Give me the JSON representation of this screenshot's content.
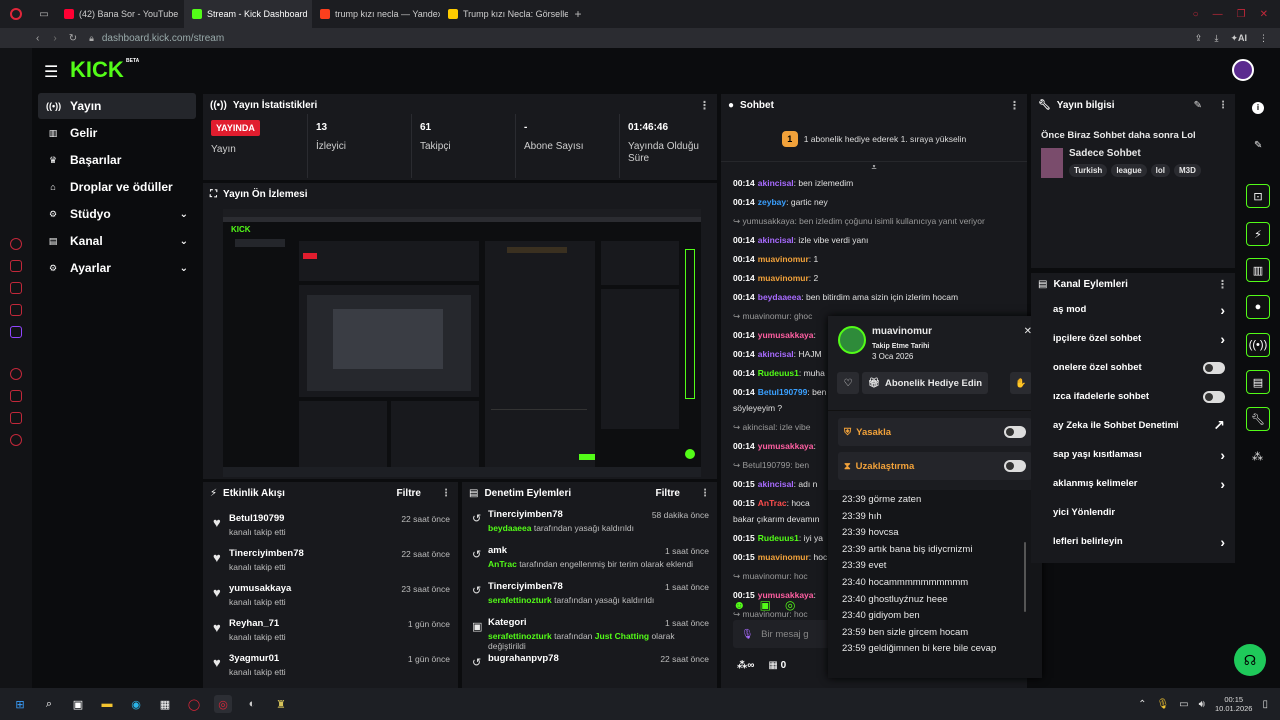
{
  "browser": {
    "tabs": [
      {
        "label": "(42) Bana Sor - YouTube",
        "icon": "youtube-icon",
        "color": "#ff0033"
      },
      {
        "label": "Stream - Kick Dashboard",
        "icon": "kick-icon",
        "color": "#53fc18",
        "active": true
      },
      {
        "label": "trump kızı necla — Yandex",
        "icon": "yandex-icon",
        "color": "#fc3f1d"
      },
      {
        "label": "Trump kızı Necla: Görseller",
        "icon": "images-icon",
        "color": "#ffcc00"
      }
    ],
    "url": "dashboard.kick.com/stream",
    "ai_label": "AI"
  },
  "kick": {
    "logo": "KICK",
    "beta": "BETA"
  },
  "nav": {
    "items": [
      {
        "label": "Yayın",
        "icon": "broadcast-icon",
        "chevron": ""
      },
      {
        "label": "Gelir",
        "icon": "money-icon",
        "chevron": ""
      },
      {
        "label": "Başarılar",
        "icon": "trophy-icon",
        "chevron": ""
      },
      {
        "label": "Droplar ve ödüller",
        "icon": "gift-icon",
        "chevron": ""
      },
      {
        "label": "Stüdyo",
        "icon": "studio-icon",
        "chevron": "⌄"
      },
      {
        "label": "Kanal",
        "icon": "channel-icon",
        "chevron": "⌄"
      },
      {
        "label": "Ayarlar",
        "icon": "settings-icon",
        "chevron": "⌄"
      }
    ]
  },
  "stats": {
    "title": "Yayın İstatistikleri",
    "live_badge": "YAYINDA",
    "live_label": "Yayın",
    "viewers": {
      "value": "13",
      "label": "İzleyici"
    },
    "followers": {
      "value": "61",
      "label": "Takipçi"
    },
    "subs": {
      "value": "-",
      "label": "Abone Sayısı"
    },
    "uptime": {
      "value": "01:46:46",
      "label": "Yayında Olduğu Süre"
    }
  },
  "preview": {
    "title": "Yayın Ön İzlemesi"
  },
  "activity": {
    "title": "Etkinlik Akışı",
    "filter": "Filtre",
    "items": [
      {
        "name": "Betul190799",
        "sub": "kanalı takip etti",
        "time": "22 saat önce"
      },
      {
        "name": "Tinerciyimben78",
        "sub": "kanalı takip etti",
        "time": "22 saat önce"
      },
      {
        "name": "yumusakkaya",
        "sub": "kanalı takip etti",
        "time": "23 saat önce"
      },
      {
        "name": "Reyhan_71",
        "sub": "kanalı takip etti",
        "time": "1 gün önce"
      },
      {
        "name": "3yagmur01",
        "sub": "kanalı takip etti",
        "time": "1 gün önce"
      }
    ]
  },
  "moderation": {
    "title": "Denetim Eylemleri",
    "filter": "Filtre",
    "items": [
      {
        "name": "Tinerciyimben78",
        "time": "58 dakika önce",
        "actor": "beydaaeea",
        "text": " tarafından yasağı kaldırıldı"
      },
      {
        "name": "amk",
        "time": "1 saat önce",
        "actor": "AnTrac",
        "text": " tarafından engellenmiş bir terim olarak eklendi"
      },
      {
        "name": "Tinerciyimben78",
        "time": "1 saat önce",
        "actor": "serafettinozturk",
        "text": " tarafından yasağı kaldırıldı"
      },
      {
        "name": "Kategori",
        "time": "1 saat önce",
        "actor": "serafettinozturk",
        "text": " tarafından ",
        "extra": "Just Chatting",
        "text2": " olarak değiştirildi"
      },
      {
        "name": "bugrahanpvp78",
        "time": "22 saat önce",
        "actor": "",
        "text": ""
      }
    ]
  },
  "chat": {
    "title": "Sohbet",
    "pinned": "1 abonelik hediye ederek 1. sıraya yükselin",
    "lines": [
      {
        "time": "00:14",
        "user": "akincisal",
        "color": "#a86bff",
        "msg": "ben izlemedim"
      },
      {
        "time": "00:14",
        "user": "zeybay",
        "color": "#3aa0ff",
        "msg": "gartic ney"
      },
      {
        "reply": "yumusakkaya: ben izledim çoğunu isimli kullanıcıya yanıt veriyor"
      },
      {
        "time": "00:14",
        "user": "akincisal",
        "color": "#a86bff",
        "msg": "izle vibe verdi yanı"
      },
      {
        "time": "00:14",
        "user": "muavinomur",
        "color": "#f2a23a",
        "msg": "1"
      },
      {
        "time": "00:14",
        "user": "muavinomur",
        "color": "#f2a23a",
        "msg": "2"
      },
      {
        "time": "00:14",
        "user": "beydaaeea",
        "color": "#a86bff",
        "msg": "ben bitirdim ama sizin için izlerim hocam"
      },
      {
        "reply": "muavinomur: ghoc"
      },
      {
        "time": "00:14",
        "user": "yumusakkaya",
        "color": "#ff5fa2",
        "msg": ""
      },
      {
        "time": "00:14",
        "user": "akincisal",
        "color": "#a86bff",
        "msg": "HAJM"
      },
      {
        "time": "00:14",
        "user": "Rudeuus1",
        "color": "#53fc18",
        "msg": "muha"
      },
      {
        "time": "00:14",
        "user": "Betul190799",
        "color": "#3aa0ff",
        "msg": "ben"
      },
      {
        "plain": "söyleyeyim ?"
      },
      {
        "reply": "akincisal: izle vibe"
      },
      {
        "time": "00:14",
        "user": "yumusakkaya",
        "color": "#ff5fa2",
        "msg": ""
      },
      {
        "reply": "Betul190799: ben"
      },
      {
        "time": "00:15",
        "user": "akincisal",
        "color": "#a86bff",
        "msg": "adı n"
      },
      {
        "time": "00:15",
        "user": "AnTrac",
        "color": "#ff4d4d",
        "msg": "hoca"
      },
      {
        "plain": "bakar çıkarım devamın"
      },
      {
        "time": "00:15",
        "user": "Rudeuus1",
        "color": "#53fc18",
        "msg": "iyi ya"
      },
      {
        "time": "00:15",
        "user": "muavinomur",
        "color": "#f2a23a",
        "msg": "hoc"
      },
      {
        "reply": "muavinomur: hoc"
      },
      {
        "time": "00:15",
        "user": "yumusakkaya",
        "color": "#ff5fa2",
        "msg": ""
      },
      {
        "reply": "muavinomur: hoc"
      },
      {
        "time": "00:15",
        "user": "beydaaeea",
        "color": "#a86bff",
        "msg": ""
      }
    ],
    "input_placeholder": "Bir mesaj g",
    "counter": "0"
  },
  "user_card": {
    "username": "muavinomur",
    "follow_label": "Takip Etme Tarihi",
    "follow_date": "3 Oca 2026",
    "gift_button": "Abonelik Hediye Edin",
    "ban_label": "Yasakla",
    "timeout_label": "Uzaklaştırma",
    "messages": [
      {
        "time": "23:39",
        "msg": "görme zaten"
      },
      {
        "time": "23:39",
        "msg": "hıh"
      },
      {
        "time": "23:39",
        "msg": "hovcsa"
      },
      {
        "time": "23:39",
        "msg": "artık bana biş idiycrnizmi"
      },
      {
        "time": "23:39",
        "msg": "evet"
      },
      {
        "time": "23:40",
        "msg": "hocammmmmmmmmm"
      },
      {
        "time": "23:40",
        "msg": "ghostluyźnuz heee"
      },
      {
        "time": "23:40",
        "msg": "gidiyom ben"
      },
      {
        "time": "23:59",
        "msg": "ben sizle gircem hocam"
      },
      {
        "time": "23:59",
        "msg": "geldiğimnen bi kere bile cevap"
      }
    ]
  },
  "stream_info": {
    "title": "Yayın bilgisi",
    "stream_title": "Önce Biraz Sohbet daha sonra Lol",
    "category": "Sadece Sohbet",
    "tags": [
      "Turkish",
      "league",
      "lol",
      "M3D"
    ]
  },
  "channel_actions": {
    "title": "Kanal Eylemleri",
    "rows": [
      {
        "label": "aş mod",
        "end": "›"
      },
      {
        "label": "ipçilere özel sohbet",
        "end": "›"
      },
      {
        "label": "onelere özel sohbet",
        "end": "toggle"
      },
      {
        "label": "ızca ifadelerle sohbet",
        "end": "toggle"
      },
      {
        "label": "ay Zeka ile Sohbet Denetimi",
        "end": "↗"
      },
      {
        "label": "sap yaşı kısıtlaması",
        "end": "›"
      },
      {
        "label": "aklanmış kelimeler",
        "end": "›"
      },
      {
        "label": "yici Yönlendir",
        "end": ""
      },
      {
        "label": "lefleri belirleyin",
        "end": "›"
      }
    ]
  },
  "taskbar": {
    "time": "00:15",
    "date": "10.01.2026"
  },
  "colors": {
    "accent": "#53fc18",
    "live": "#e11d2e",
    "panel": "#18191d",
    "bg": "#0b0c0e"
  }
}
